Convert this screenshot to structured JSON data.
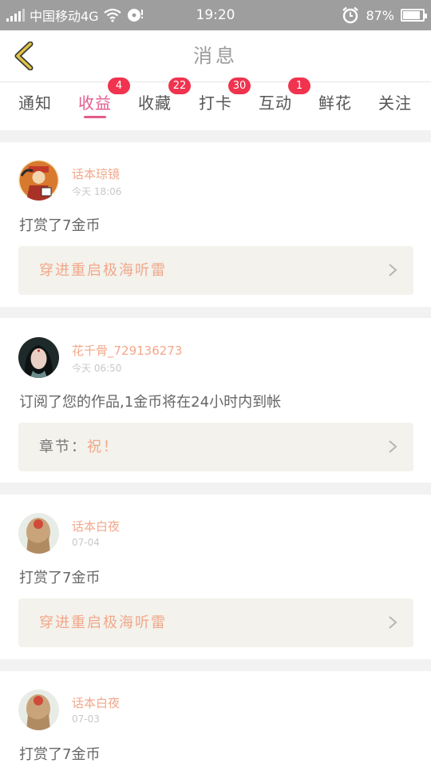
{
  "status_bar": {
    "carrier": "中国移动4G",
    "time": "19:20",
    "battery": "87%",
    "battery_level": 0.87,
    "icons": [
      "signal-icon",
      "wifi-icon",
      "disc-icon",
      "alarm-icon",
      "battery-icon"
    ]
  },
  "header": {
    "title": "消息",
    "back_icon": "chevron-left-icon"
  },
  "tabs": [
    {
      "label": "通知",
      "badge": ""
    },
    {
      "label": "收益",
      "badge": "4",
      "active": true
    },
    {
      "label": "收藏",
      "badge": "22"
    },
    {
      "label": "打卡",
      "badge": "30"
    },
    {
      "label": "互动",
      "badge": "1"
    },
    {
      "label": "鲜花",
      "badge": ""
    },
    {
      "label": "关注",
      "badge": ""
    }
  ],
  "messages": [
    {
      "user": "话本琼镜",
      "time": "今天 18:06",
      "text": "打赏了7金币",
      "link": "穿进重启极海听雷",
      "link_prefix": ""
    },
    {
      "user": "花千骨_729136273",
      "time": "今天 06:50",
      "text": "订阅了您的作品,1金币将在24小时内到帐",
      "link": "祝！",
      "link_prefix": "章节："
    },
    {
      "user": "话本白夜",
      "time": "07-04",
      "text": "打赏了7金币",
      "link": "穿进重启极海听雷",
      "link_prefix": ""
    },
    {
      "user": "话本白夜",
      "time": "07-03",
      "text": "打赏了7金币",
      "link": "",
      "link_prefix": ""
    }
  ],
  "colors": {
    "accent": "#e35c8e",
    "badge": "#f0334f",
    "username": "#f2a78a",
    "back_arrow": "#e0c441"
  }
}
